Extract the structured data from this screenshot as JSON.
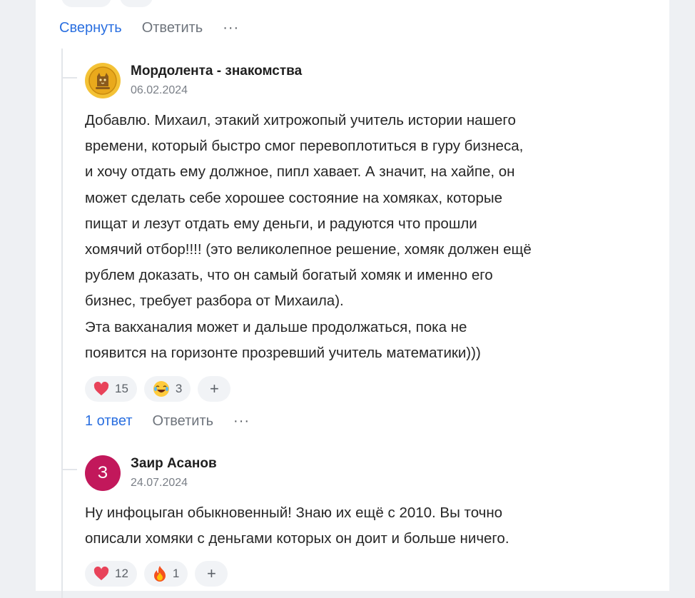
{
  "top_actions": {
    "collapse_label": "Свернуть",
    "reply_label": "Ответить",
    "more_label": "···"
  },
  "comments": [
    {
      "author": "Мордолента - знакомства",
      "date": "06.02.2024",
      "avatar": {
        "type": "image",
        "icon": "cat-coin-logo",
        "color": "#e8b529"
      },
      "text": "Добавлю. Михаил, этакий хитрожопый учитель истории нашего\nвремени, который быстро смог перевоплотиться в гуру бизнеса,\nи хочу отдать ему должное, пипл хавает. А значит, на хайпе, он\nможет сделать себе хорошее состояние на хомяках, которые\nпищат и лезут отдать ему деньги, и радуются что прошли\nхомячий отбор!!!! (это великолепное решение, хомяк должен ещё\nрублем доказать, что он самый богатый хомяк и именно его\nбизнес, требует разбора от Михаила).\nЭта вакханалия может и дальше продолжаться, пока не\nпоявится на горизонте прозревший учитель математики)))",
      "reactions": [
        {
          "icon": "heart-icon",
          "count": "15"
        },
        {
          "icon": "laughing-emoji-icon",
          "count": "3"
        }
      ],
      "add_reaction_label": "+",
      "replies_label": "1 ответ",
      "reply_label": "Ответить",
      "more_label": "···"
    },
    {
      "author": "Заир Асанов",
      "date": "24.07.2024",
      "avatar": {
        "type": "letter",
        "letter": "З",
        "color": "#c2185b"
      },
      "text": "Ну инфоцыган обыкновенный! Знаю их ещё с 2010. Вы точно\nописали хомяки с деньгами которых он доит и больше ничего.",
      "reactions": [
        {
          "icon": "heart-icon",
          "count": "12"
        },
        {
          "icon": "fire-emoji-icon",
          "count": "1"
        }
      ],
      "add_reaction_label": "+"
    }
  ],
  "colors": {
    "link": "#2a6fe0",
    "muted": "#6e747c",
    "heart": "#e8435a",
    "pill_bg": "#f1f3f6"
  }
}
